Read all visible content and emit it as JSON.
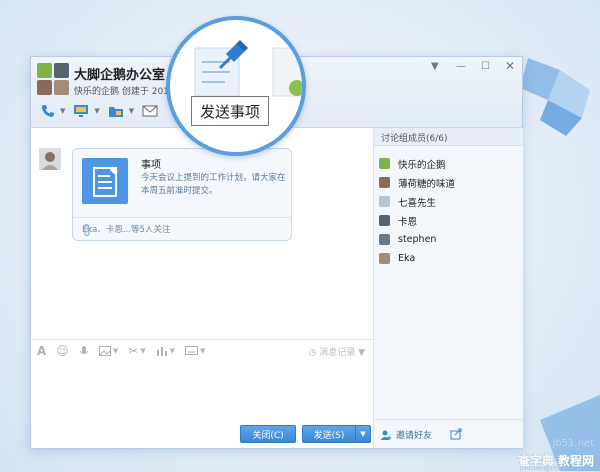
{
  "window": {
    "group_name": "大脚企鹅办公室",
    "subtitle": "快乐的企鹅 创建于 201"
  },
  "zoom": {
    "tooltip": "发送事项"
  },
  "message": {
    "card_title": "事项",
    "card_body": "今天会议上提到的工作计划，请大家在本周五前准时提交。",
    "card_footer": "Eka、卡恩...等5人关注"
  },
  "input": {
    "history_label": "消息记录"
  },
  "buttons": {
    "close": "关闭(C)",
    "send": "发送(S)"
  },
  "panel": {
    "title": "讨论组成员(6/6)",
    "members": [
      {
        "name": "快乐的企鹅",
        "color": "#7fb34a"
      },
      {
        "name": "薄荷糖的味道",
        "color": "#8a6a5a"
      },
      {
        "name": "七喜先生",
        "color": "#b8c4cf"
      },
      {
        "name": "卡恩",
        "color": "#556270"
      },
      {
        "name": "stephen",
        "color": "#6b7a88"
      },
      {
        "name": "Eka",
        "color": "#a48b78"
      }
    ],
    "invite_label": "邀请好友"
  },
  "watermark": {
    "line1": "jb51.net",
    "line2": "查字典 教程网",
    "line3": "jiaocheng.chazidian.com"
  },
  "colors": {
    "accent": "#4d96e4",
    "button": "#3b87d6",
    "zoom_ring": "#5b9ede"
  }
}
